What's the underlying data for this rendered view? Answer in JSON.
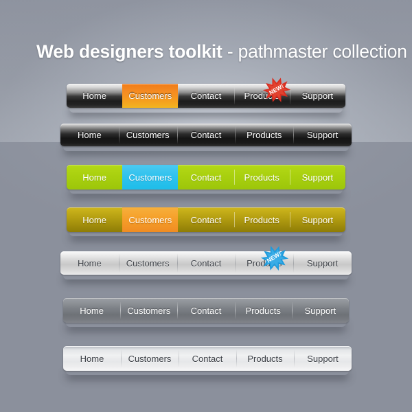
{
  "page": {
    "background_upper": "#959aa5",
    "background_lower": "#8b909c"
  },
  "title": {
    "bold_part": "Web designers toolkit",
    "light_part": " - pathmaster collection"
  },
  "badges": {
    "red": {
      "label": "NEW!",
      "color": "#d92d20",
      "icon": "starburst-badge-icon"
    },
    "blue": {
      "label": "NEW!",
      "color": "#1f9bdc",
      "icon": "starburst-badge-icon"
    }
  },
  "navbars": [
    {
      "id": "bar1",
      "style_name": "dark-silver-orange",
      "accent": "#f4960f",
      "items": [
        {
          "label": "Home",
          "active": false
        },
        {
          "label": "Customers",
          "active": true
        },
        {
          "label": "Contact",
          "active": false
        },
        {
          "label": "Products",
          "active": false,
          "badge": "red"
        },
        {
          "label": "Support",
          "active": false
        }
      ]
    },
    {
      "id": "bar2",
      "style_name": "black-gloss",
      "accent": "#141414",
      "items": [
        {
          "label": "Home",
          "active": false
        },
        {
          "label": "Customers",
          "active": false
        },
        {
          "label": "Contact",
          "active": false
        },
        {
          "label": "Products",
          "active": false
        },
        {
          "label": "Support",
          "active": false
        }
      ]
    },
    {
      "id": "bar3",
      "style_name": "lime-cyan",
      "accent": "#2dc2ee",
      "items": [
        {
          "label": "Home",
          "active": false
        },
        {
          "label": "Customers",
          "active": true
        },
        {
          "label": "Contact",
          "active": false
        },
        {
          "label": "Products",
          "active": false
        },
        {
          "label": "Support",
          "active": false
        }
      ]
    },
    {
      "id": "bar4",
      "style_name": "olive-orange",
      "accent": "#f59f2a",
      "items": [
        {
          "label": "Home",
          "active": false
        },
        {
          "label": "Customers",
          "active": true
        },
        {
          "label": "Contact",
          "active": false
        },
        {
          "label": "Products",
          "active": false
        },
        {
          "label": "Support",
          "active": false
        }
      ]
    },
    {
      "id": "bar5",
      "style_name": "white-silver",
      "accent": "#c8c8c8",
      "items": [
        {
          "label": "Home",
          "active": false
        },
        {
          "label": "Customers",
          "active": false
        },
        {
          "label": "Contact",
          "active": false
        },
        {
          "label": "Products",
          "active": false,
          "badge": "blue"
        },
        {
          "label": "Support",
          "active": false
        }
      ]
    },
    {
      "id": "bar6",
      "style_name": "mid-grey",
      "accent": "#7b7f85",
      "items": [
        {
          "label": "Home",
          "active": false
        },
        {
          "label": "Customers",
          "active": false
        },
        {
          "label": "Contact",
          "active": false
        },
        {
          "label": "Products",
          "active": false
        },
        {
          "label": "Support",
          "active": false
        }
      ]
    },
    {
      "id": "bar7",
      "style_name": "light-silver",
      "accent": "#eef0f1",
      "items": [
        {
          "label": "Home",
          "active": false
        },
        {
          "label": "Customers",
          "active": false
        },
        {
          "label": "Contact",
          "active": false
        },
        {
          "label": "Products",
          "active": false
        },
        {
          "label": "Support",
          "active": false
        }
      ]
    }
  ]
}
